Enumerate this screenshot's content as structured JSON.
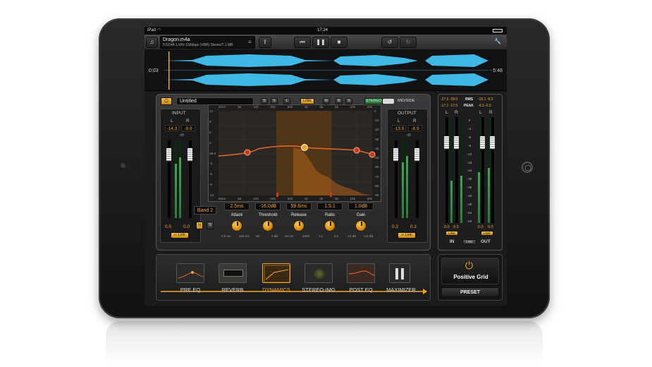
{
  "status_bar": {
    "device": "iPad",
    "time": "17:24"
  },
  "toolbar": {
    "file_name": "Dragon.m4a",
    "file_info": "5:52/44.1 kHz 156kbps (VBR) Stereo/7.1 MB"
  },
  "waveform": {
    "time_left": "0:03",
    "time_right": "- 5:48"
  },
  "panel": {
    "preset_name": "Untitled",
    "mode_buttons": [
      "S",
      "S",
      "L",
      "LINK",
      "R",
      "B",
      "S"
    ],
    "stereo_label": "STEREO",
    "midside_label": "MID/SIDE"
  },
  "input": {
    "title": "INPUT",
    "l": "L",
    "r": "R",
    "peak_l": "-14.3",
    "peak_r": "-9.9",
    "db_label": "dB",
    "gain_l": "0.0",
    "gain_r": "0.0",
    "link_label": "Link"
  },
  "output": {
    "title": "OUTPUT",
    "l": "L",
    "r": "R",
    "peak_l": "-13.5",
    "peak_r": "-8.9",
    "db_label": "dB",
    "gain_l": "0.2",
    "gain_r": "0.2",
    "link_label": "Link"
  },
  "eq": {
    "freq_labels_top": [
      "20Hz",
      "50",
      "100",
      "200",
      "500",
      "1k",
      "2k",
      "5k",
      "10k",
      "20k"
    ],
    "freq_labels_bottom": [
      "20Hz",
      "50",
      "100",
      "200",
      "500",
      "1k",
      "2k",
      "5k",
      "10k",
      "20k"
    ],
    "db_left": [
      "12",
      "9",
      "6",
      "3",
      "dB 0",
      "-3",
      "-6",
      "-9",
      "-12"
    ],
    "db_right": [
      "0",
      "-10",
      "-20",
      "-30",
      "-40",
      "-50",
      "-60",
      "-70",
      "-80",
      "-90"
    ]
  },
  "dynamics": {
    "band_label": "Band 2",
    "n_label": "N",
    "s_label": "S",
    "params": [
      {
        "value": "2.5ms",
        "label": "Attack",
        "min": "0.5 ms",
        "max": "100 ms"
      },
      {
        "value": "-16.0dB",
        "label": "Threshold",
        "min": "-60",
        "max": "0 dB"
      },
      {
        "value": "59.6ms",
        "label": "Release",
        "min": "20 ms",
        "max": "2000"
      },
      {
        "value": "1.5:1",
        "label": "Ratio",
        "min": "1:1",
        "max": "8:1"
      },
      {
        "value": "1.0dB",
        "label": "Gain",
        "min": "-12 dB",
        "max": "+12 dB"
      }
    ]
  },
  "master_meter": {
    "rms_left": "-27.5 -28.0",
    "rms_label": "RMS",
    "rms_right": "-16.1 -8.3",
    "peak_left": "-17.1 -17.5",
    "peak_label": "PEAK",
    "peak_right": "-4.3 -0.3",
    "l": "L",
    "r": "R",
    "scale": [
      "0",
      "-3",
      "-6",
      "-9",
      "-12",
      "-18",
      "-24",
      "-30",
      "-36",
      "-42",
      "-48",
      "-54",
      "-60"
    ],
    "in_gain_l": "0.0",
    "in_gain_r": "0.0",
    "out_gain_l": "0.0",
    "out_gain_r": "0.0",
    "link_label": "LINK",
    "in_label": "IN",
    "out_label": "OUT"
  },
  "chain": {
    "modules": [
      "PRE EQ",
      "REVERB",
      "DYNAMICS",
      "STEREO-IMG",
      "POST EQ",
      "MAXIMIZER"
    ],
    "active": "DYNAMICS"
  },
  "brand": {
    "name": "Positive Grid",
    "preset_button": "PRESET"
  },
  "colors": {
    "accent": "#f5a623",
    "wave": "#3fb8e6",
    "meter_green": "#3ea850"
  }
}
